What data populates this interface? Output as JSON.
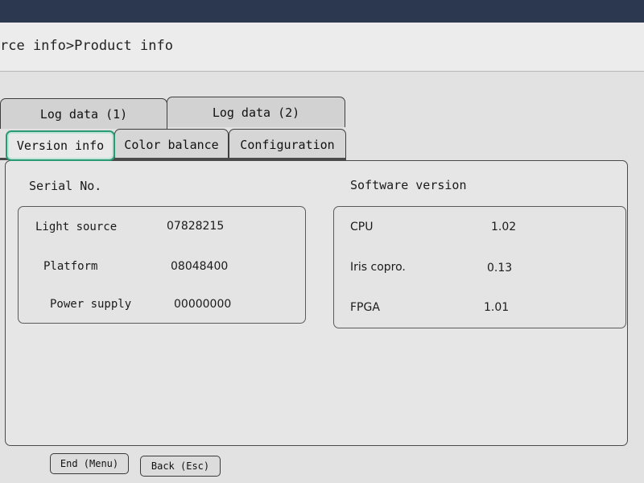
{
  "header": {
    "breadcrumb": "rce info>Product info"
  },
  "tabs": {
    "row_back": [
      {
        "label": "Log data (1)"
      },
      {
        "label": "Log data (2)"
      }
    ],
    "row_front": [
      {
        "label": "Version info",
        "active": true
      },
      {
        "label": "Color balance"
      },
      {
        "label": "Configuration"
      }
    ]
  },
  "serial": {
    "title": "Serial No.",
    "rows": [
      {
        "label": "Light source",
        "value": "07828215"
      },
      {
        "label": "Platform",
        "value": "08048400"
      },
      {
        "label": "Power supply",
        "value": "00000000"
      }
    ]
  },
  "software": {
    "title": "Software version",
    "rows": [
      {
        "label": "CPU",
        "value": "1.02"
      },
      {
        "label": "Iris copro.",
        "value": "0.13"
      },
      {
        "label": "FPGA",
        "value": "1.01"
      }
    ]
  },
  "footer": {
    "end_label": "End (Menu)",
    "back_label": "Back (Esc)"
  },
  "colors": {
    "active_tab_border": "#2a9a76",
    "panel_bg": "#e6e6e6",
    "bezel": "#2b3850"
  }
}
